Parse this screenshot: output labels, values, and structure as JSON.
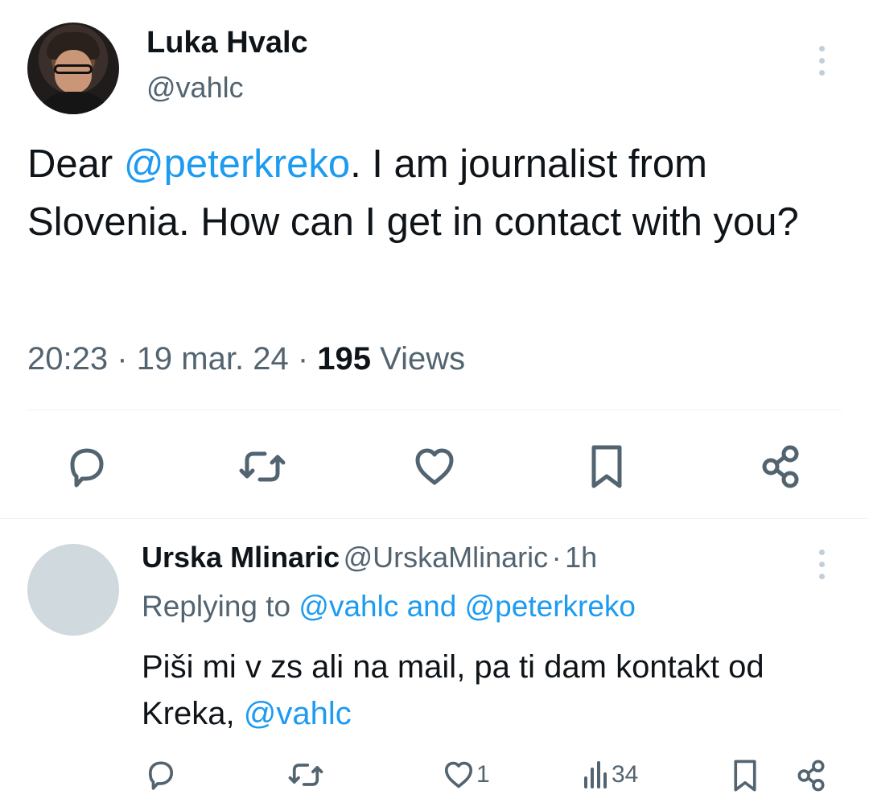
{
  "tweet": {
    "author_name": "Luka Hvalc",
    "author_handle": "@vahlc",
    "text_before": "Dear ",
    "mention": "@peterkreko",
    "text_after": ". I am journalist from Slovenia. How can I get in contact with you?",
    "time": "20:23",
    "date": "19 mar. 24",
    "views_count": "195",
    "views_label": "Views"
  },
  "reply": {
    "author_name": "Urska Mlinaric",
    "author_handle": "@UrskaMlinaric",
    "age": "1h",
    "replying_label": "Replying to",
    "replying_to_1": "@vahlc",
    "replying_and": "and",
    "replying_to_2": "@peterkreko",
    "text": "Piši mi v zs ali na mail, pa ti dam kontakt od Kreka,",
    "text_mention": "@vahlc",
    "like_count": "1",
    "views_count": "34"
  },
  "icons": {
    "reply": "reply-icon",
    "retweet": "retweet-icon",
    "like": "heart-icon",
    "bookmark": "bookmark-icon",
    "share": "share-icon",
    "views": "views-icon",
    "more": "more-icon"
  },
  "colors": {
    "link": "#1d9bf0",
    "secondary_text": "#536471",
    "primary_text": "#0f1419",
    "divider": "#eff3f4"
  }
}
